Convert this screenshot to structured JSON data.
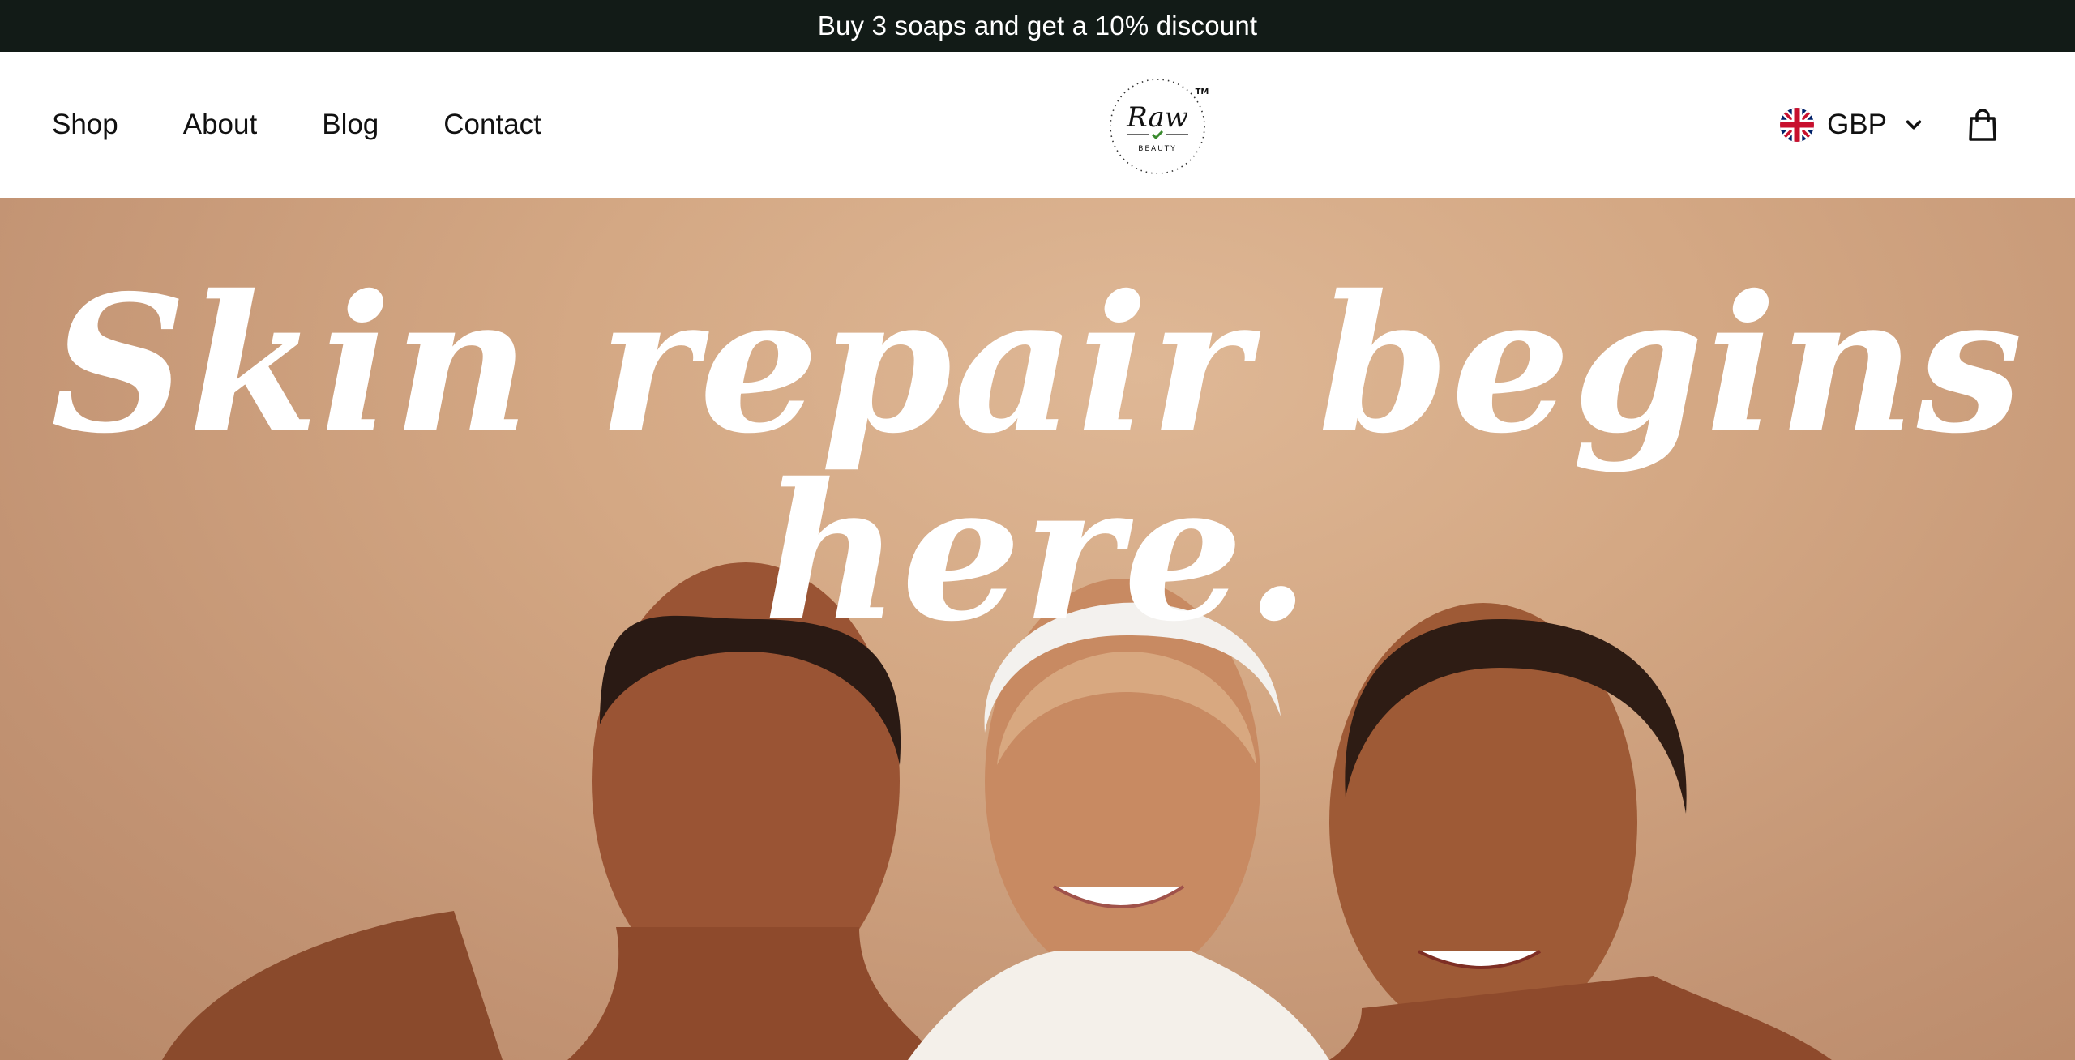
{
  "announcement": {
    "text": "Buy 3 soaps and get a 10% discount"
  },
  "nav": {
    "items": [
      {
        "label": "Shop"
      },
      {
        "label": "About"
      },
      {
        "label": "Blog"
      },
      {
        "label": "Contact"
      }
    ]
  },
  "logo": {
    "wordmark": "Raw",
    "subtitle": "BEAUTY",
    "tm": "TM",
    "icon": "checkmark-leaf-icon"
  },
  "currency": {
    "label": "GBP",
    "flag_icon": "uk-flag-icon",
    "dropdown_icon": "chevron-down-icon"
  },
  "cart": {
    "icon": "shopping-bag-icon"
  },
  "hero": {
    "headline": "Skin repair begins here.",
    "image": "three-women-smiling-photo"
  },
  "colors": {
    "announcement_bg": "#121b17",
    "hero_bg": "#d4a884",
    "headline": "#ffffff",
    "logo_check": "#3a8a2e"
  }
}
